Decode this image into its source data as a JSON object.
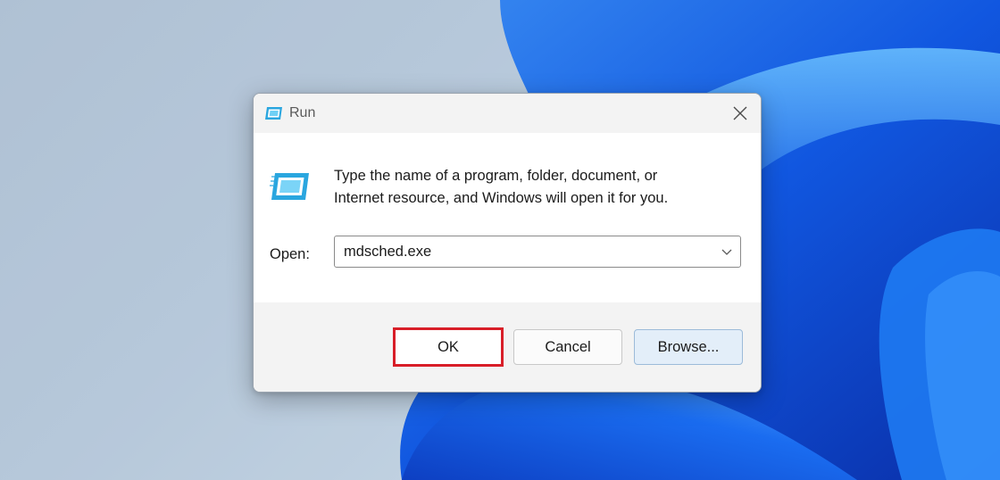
{
  "dialog": {
    "title": "Run",
    "description_line1": "Type the name of a program, folder, document, or",
    "description_line2": "Internet resource, and Windows will open it for you.",
    "open_label": "Open:",
    "open_value": "mdsched.exe"
  },
  "buttons": {
    "ok_label": "OK",
    "cancel_label": "Cancel",
    "browse_label": "Browse..."
  },
  "icons": {
    "run_icon": "run-app-icon",
    "close_icon": "close-x-icon",
    "dropdown_icon": "chevron-down-icon"
  },
  "colors": {
    "highlight": "#d81e28",
    "accent_blue": "#1a5fd6",
    "run_icon_blue": "#2aa6df"
  }
}
